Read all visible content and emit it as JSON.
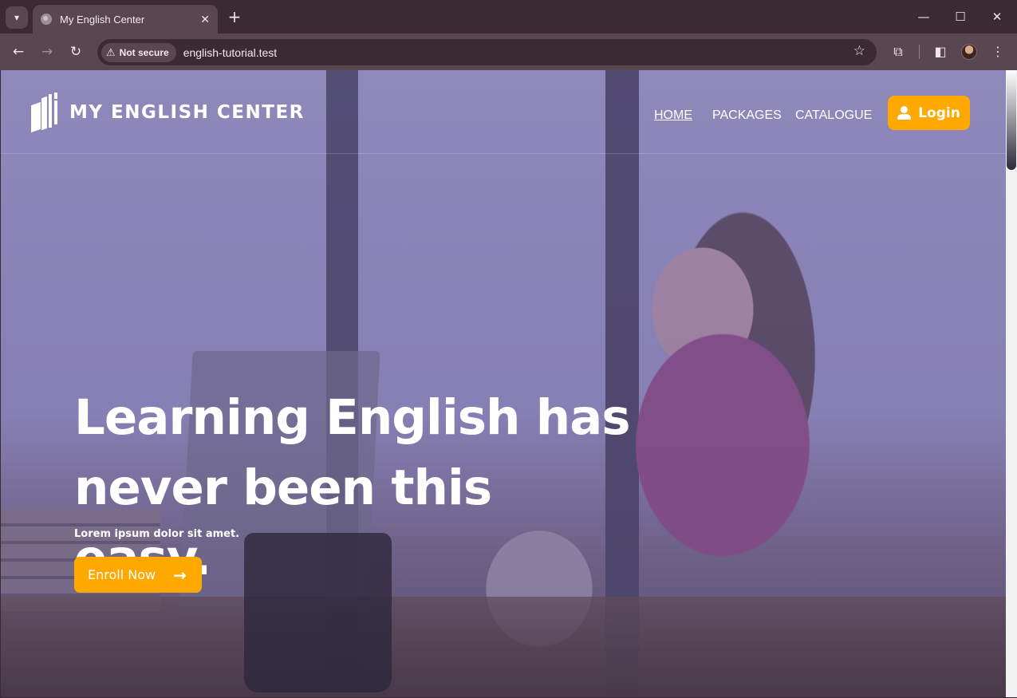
{
  "browser": {
    "tab_title": "My English Center",
    "tab_close": "✕",
    "new_tab": "+",
    "security_chip": "Not secure",
    "url": "english-tutorial.test",
    "window_controls": {
      "minimize": "—",
      "maximize": "☐",
      "close": "✕"
    }
  },
  "site": {
    "brand": "MY ENGLISH CENTER",
    "nav": [
      {
        "label": "HOME",
        "active": true
      },
      {
        "label": "PACKAGES",
        "active": false
      },
      {
        "label": "CATALOGUE",
        "active": false
      }
    ],
    "login_label": "Login"
  },
  "hero": {
    "title_line1": "Learning English has",
    "title_line2": "never been this easy.",
    "subtitle": "Lorem ipsum dolor sit amet.",
    "cta_label": "Enroll Now",
    "cta_icon": "arrow-right-icon"
  },
  "colors": {
    "accent": "#ffa800",
    "chrome_dark": "#3b2a33",
    "chrome_light": "#5a4650",
    "overlay": "#8f8cc0"
  }
}
